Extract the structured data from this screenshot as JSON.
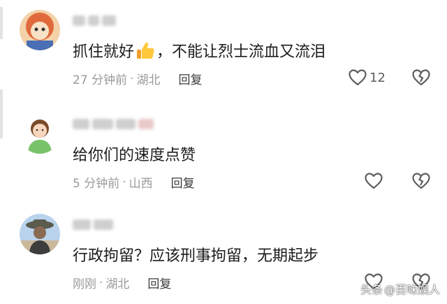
{
  "comments": [
    {
      "text_before": "抓住就好",
      "text_after": "，不能让烈士流血又流泪",
      "emoji": "thumbs-up-emoji",
      "time": "27 分钟前",
      "separator": "·",
      "location": "湖北",
      "reply_label": "回复",
      "like_count": "12"
    },
    {
      "text_before": "给你们的速度点赞",
      "text_after": "",
      "time": "5 分钟前",
      "separator": "·",
      "location": "山西",
      "reply_label": "回复",
      "like_count": ""
    },
    {
      "text_before": "行政拘留？应该刑事拘留，无期起步",
      "text_after": "",
      "time": "刚刚",
      "separator": "·",
      "location": "湖北",
      "reply_label": "回复",
      "like_count": ""
    }
  ],
  "watermark": {
    "platform": "头条",
    "account": "@百味娱人"
  },
  "colors": {
    "meta": "#9a9a9a",
    "icon": "#5d5d5d"
  }
}
